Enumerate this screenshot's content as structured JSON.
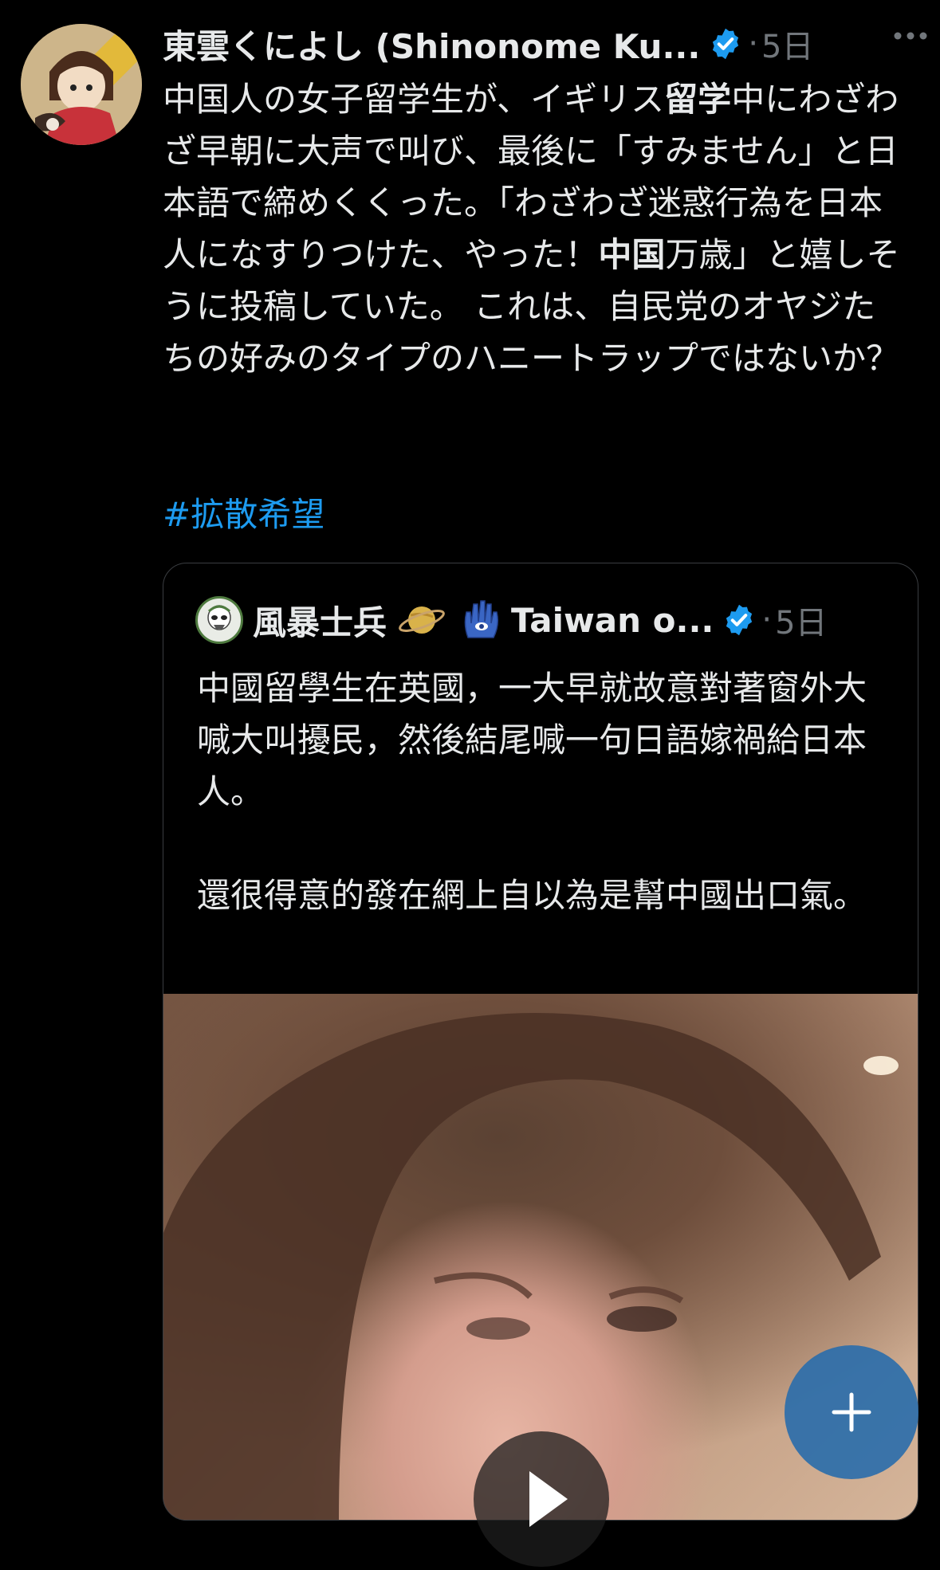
{
  "tweet": {
    "display_name": "東雲くによし (Shinonome Ku...",
    "separator": "·",
    "time": "5日",
    "text_segments": [
      {
        "text": "中国人の女子留学生が、イギリス",
        "bold": false
      },
      {
        "text": "留学",
        "bold": true
      },
      {
        "text": "中にわざわざ早朝に大声で叫び、最後に「すみません」と日本語で締めくくった。「わざわざ迷惑行為を日本人になすりつけた、やった！",
        "bold": false
      },
      {
        "text": "中国",
        "bold": true
      },
      {
        "text": "万歳」と嬉しそうに投稿していた。 これは、自民党のオヤジたちの好みのタイプのハニートラップではないか？",
        "bold": false
      }
    ],
    "hashtag": "#拡散希望"
  },
  "quote": {
    "display_name": "風暴士兵",
    "name_suffix": "Taiwan o...",
    "separator": "·",
    "time": "5日",
    "paragraph1": "中國留學生在英國，一大早就故意對著窗外大喊大叫擾民，然後結尾喊一句日語嫁禍給日本人。",
    "paragraph2": "還很得意的發在網上自以為是幫中國出口氣。"
  },
  "colors": {
    "background": "#000000",
    "text": "#e7e9ea",
    "muted": "#71767b",
    "link": "#1d9bf0",
    "verified": "#1d9bf0",
    "fab": "#2d6eaa"
  },
  "icons": {
    "verified": "verified-badge-icon",
    "more": "more-dots-icon",
    "saturn": "ringed-planet-emoji",
    "hamsa": "hamsa-emoji",
    "play": "play-icon",
    "compose": "plus-icon"
  }
}
